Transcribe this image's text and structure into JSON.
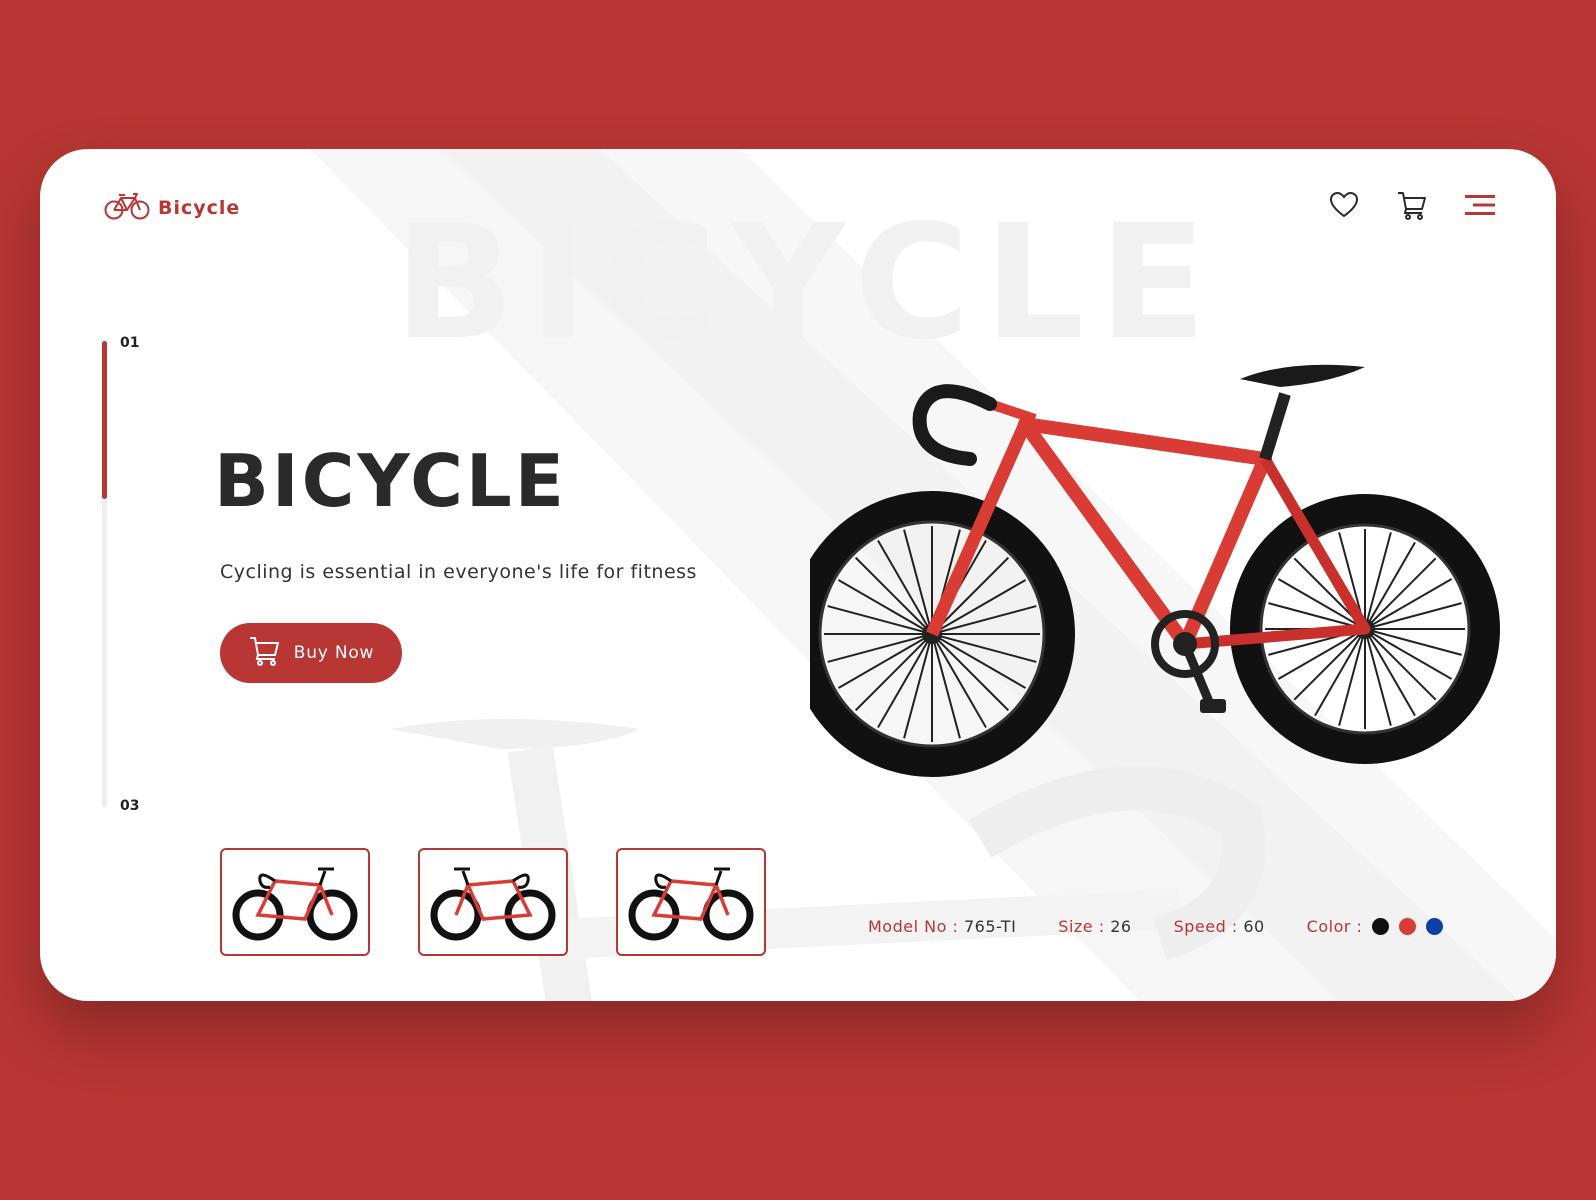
{
  "brand": {
    "name": "Bicycle"
  },
  "watermark": "BICYCLE",
  "hero": {
    "title": "BICYCLE",
    "subtitle": "Cycling is essential in everyone's life for fitness",
    "cta_label": "Buy Now"
  },
  "slider": {
    "current": "01",
    "total": "03"
  },
  "specs": {
    "model_label": "Model No :",
    "model_value": "765-TI",
    "size_label": "Size :",
    "size_value": "26",
    "speed_label": "Speed :",
    "speed_value": "60",
    "color_label": "Color :"
  },
  "colors": {
    "accent": "#b83633",
    "swatches": [
      "#111111",
      "#d93b35",
      "#0d3fa8"
    ]
  },
  "icons": [
    "bicycle-logo-icon",
    "heart-icon",
    "cart-icon",
    "menu-icon"
  ]
}
